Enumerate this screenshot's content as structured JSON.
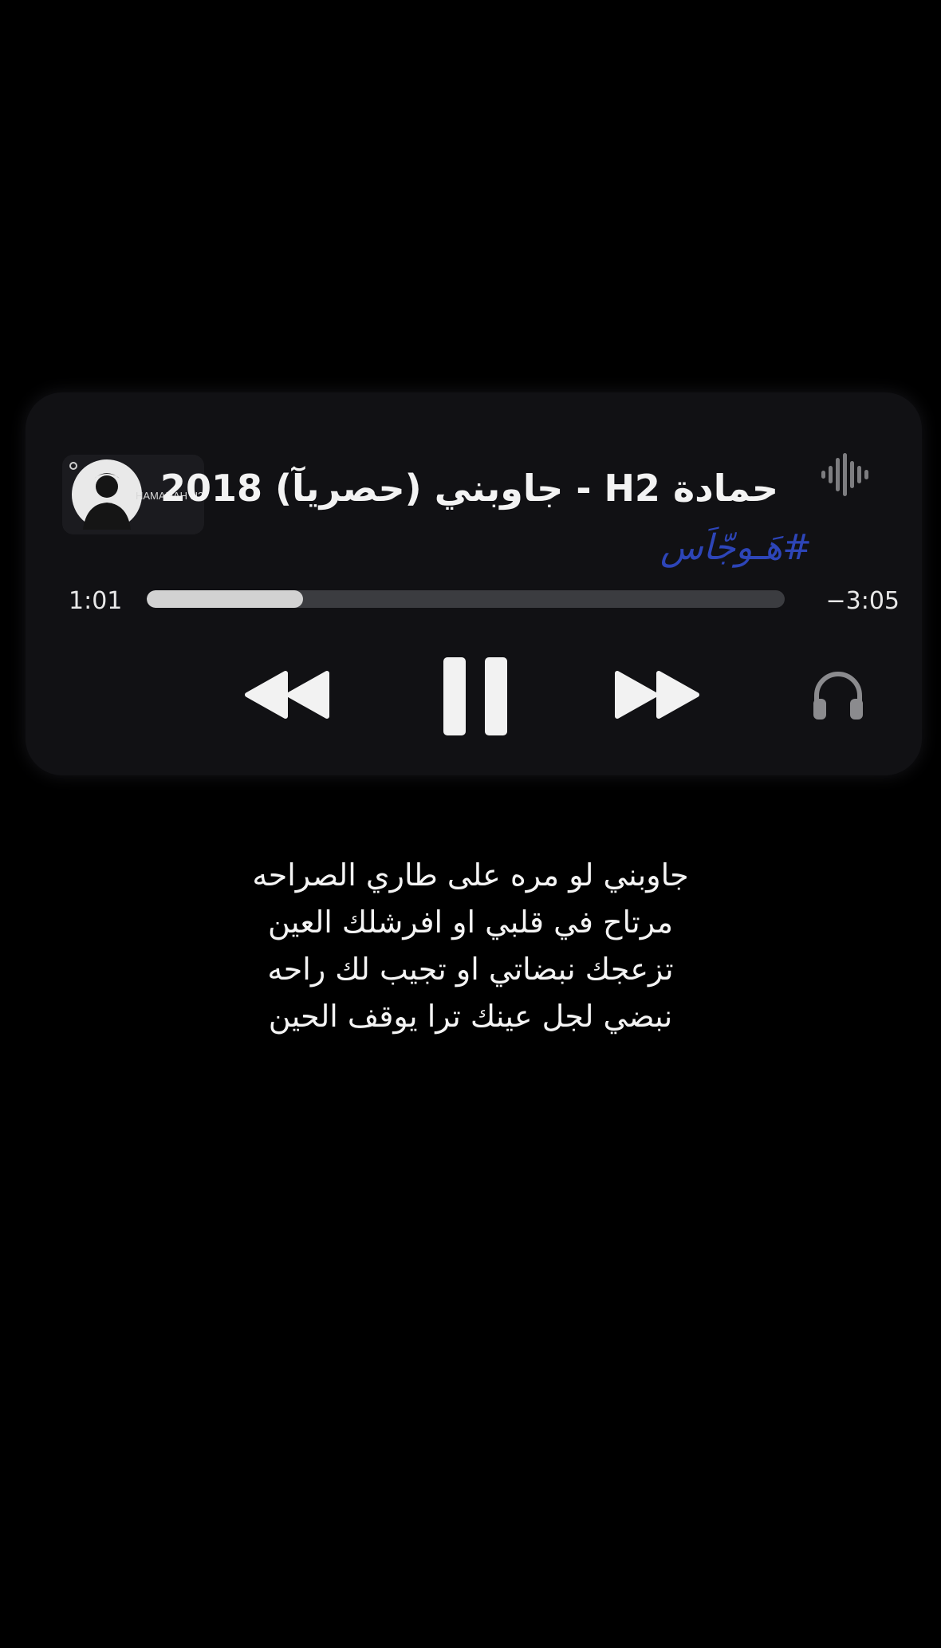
{
  "player": {
    "track_title": "حمادة H2 - جاوبني (حصريآ)  2018",
    "album_art_text": "HAMADAH H2",
    "hashtag": "#هَـوجّاَس",
    "time_elapsed": "1:01",
    "time_remaining": "−3:05",
    "progress_fraction": 0.245,
    "icons": {
      "waveform": "waveform-icon",
      "rewind": "rewind-icon",
      "pause": "pause-icon",
      "forward": "fast-forward-icon",
      "headphones": "headphones-icon"
    }
  },
  "lyrics": [
    "جاوبني لو مره على طاري الصراحه",
    "مرتاح في قلبي او افرشلك العين",
    "تزعجك نبضاتي او تجيب لك راحه",
    "نبضي لجل عينك ترا يوقف الحين"
  ],
  "colors": {
    "background": "#000000",
    "card": "#111114",
    "hashtag": "#2d45b8",
    "progress_fill": "#d2d2d2",
    "progress_track": "#3b3c40"
  }
}
